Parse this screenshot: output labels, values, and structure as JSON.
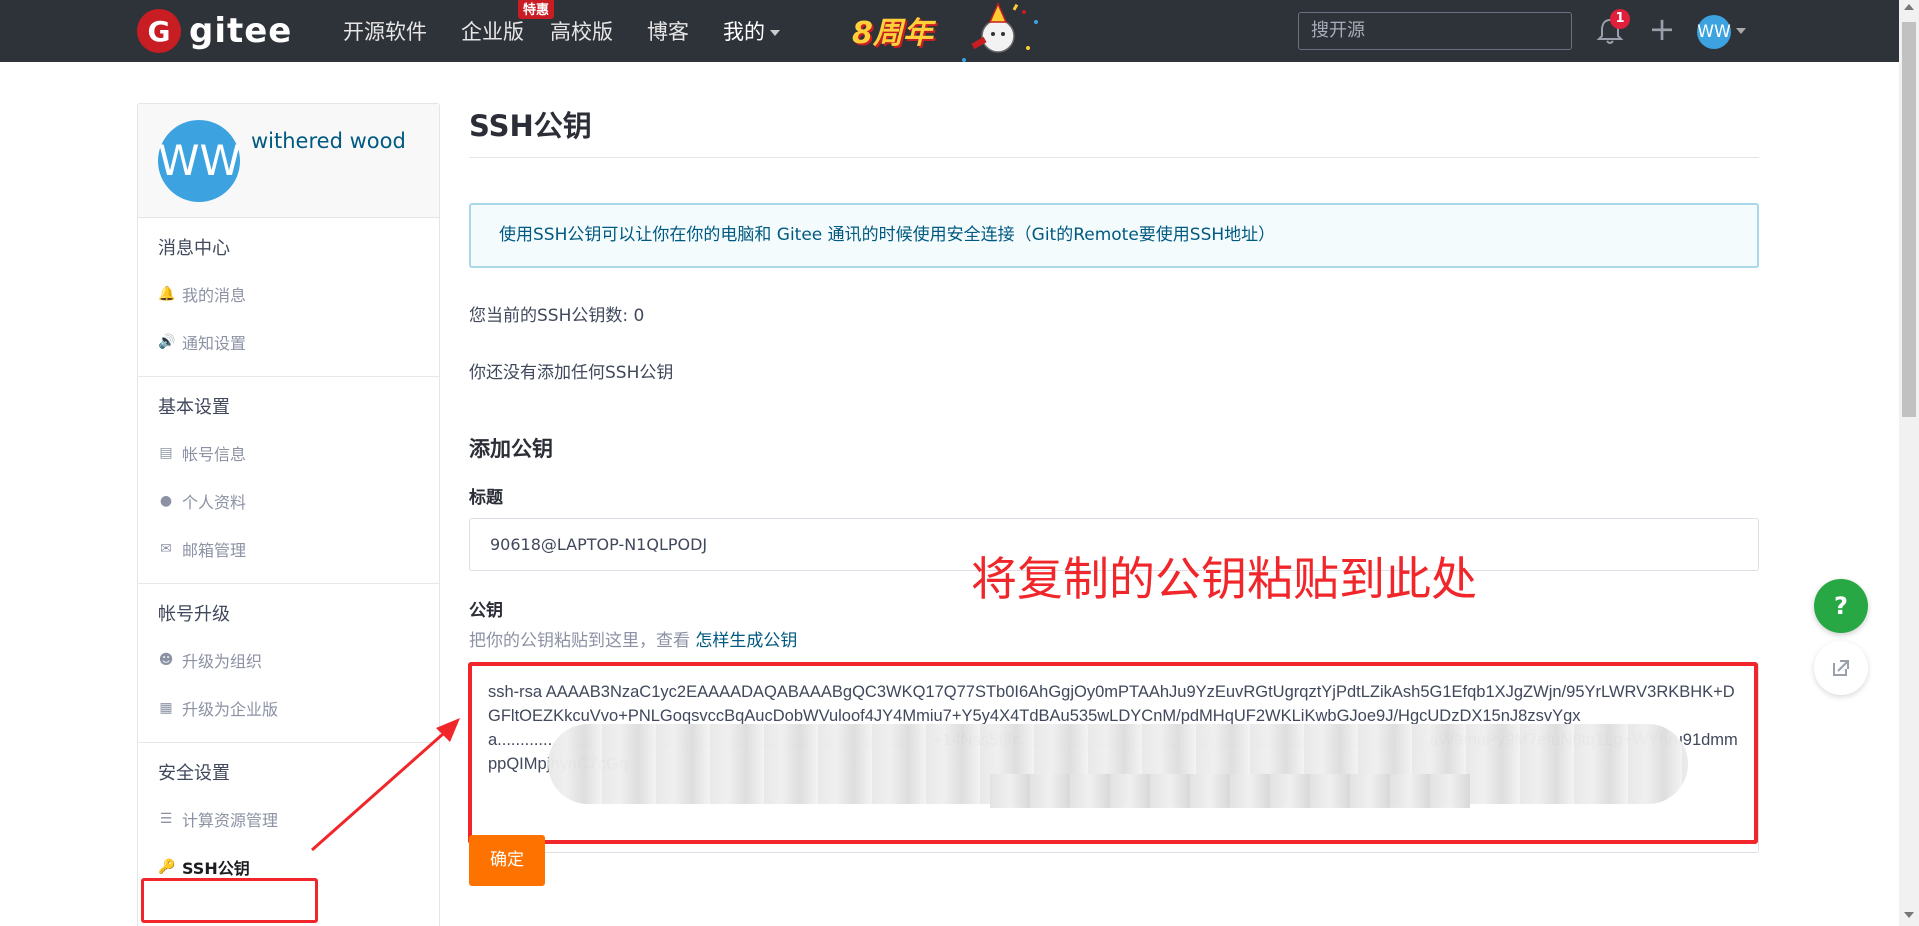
{
  "topbar": {
    "logo_mark": "G",
    "logo_text": "gitee",
    "nav": [
      {
        "label": "开源软件"
      },
      {
        "label": "企业版",
        "badge": "特惠"
      },
      {
        "label": "高校版"
      },
      {
        "label": "博客"
      },
      {
        "label": "我的"
      }
    ],
    "anniversary": "8周年",
    "search_placeholder": "搜开源",
    "notification_count": "1",
    "plus": "+",
    "avatar_initials": "WW"
  },
  "sidebar": {
    "avatar_initials": "WW",
    "username": "withered wood",
    "sections": [
      {
        "title": "消息中心",
        "items": [
          {
            "label": "我的消息",
            "icon": "bell-icon"
          },
          {
            "label": "通知设置",
            "icon": "volume-icon"
          }
        ]
      },
      {
        "title": "基本设置",
        "items": [
          {
            "label": "帐号信息",
            "icon": "id-card-icon"
          },
          {
            "label": "个人资料",
            "icon": "user-icon"
          },
          {
            "label": "邮箱管理",
            "icon": "mail-icon"
          }
        ]
      },
      {
        "title": "帐号升级",
        "items": [
          {
            "label": "升级为组织",
            "icon": "users-icon"
          },
          {
            "label": "升级为企业版",
            "icon": "building-icon"
          }
        ]
      },
      {
        "title": "安全设置",
        "items": [
          {
            "label": "计算资源管理",
            "icon": "server-icon"
          },
          {
            "label": "SSH公钥",
            "icon": "key-icon"
          }
        ]
      }
    ]
  },
  "main": {
    "title": "SSH公钥",
    "info": "使用SSH公钥可以让你在你的电脑和 Gitee 通讯的时候使用安全连接（Git的Remote要使用SSH地址）",
    "count_text": "您当前的SSH公钥数: 0",
    "none_text": "你还没有添加任何SSH公钥",
    "add_title": "添加公钥",
    "title_label": "标题",
    "title_value": "90618@LAPTOP-N1QLPODJ",
    "key_label": "公钥",
    "key_hint": "把你的公钥粘贴到这里，查看",
    "key_hint_link": "怎样生成公钥",
    "key_value": "ssh-rsa AAAAB3NzaC1yc2EAAAADAQABAAABgQC3WKQ17Q77STb0I6AhGgjOy0mPTAAhJu9YzEuvRGtUgrqztYjPdtLZikAsh5G1Efqb1XJgZWjn/95YrLWRV3RKBHK+DGFltOEZKkcuVvo+PNLGoqsvccBqAucDobWVuloof4JY4Mmiu7+Y5y4X4TdBAu535wLDYCnM/pdMHqUF2WKLiKwbGJoe9J/HgcUDzDX15nJ8zsvYgxa...............................................................................................+14Nss5I3r..........................................................................................aW9muPy9M7efuN8tq1Lg+WYhru91dmmppQIMpjhynC7cGq",
    "annotation": "将复制的公钥粘贴到此处",
    "submit_label": "确定"
  },
  "floating": {
    "help": "?"
  },
  "colors": {
    "topbar": "#2e3239",
    "brand_red": "#c71d23",
    "submit_orange": "#fe7300",
    "annotation_red": "#f0262a",
    "link": "#005980"
  }
}
